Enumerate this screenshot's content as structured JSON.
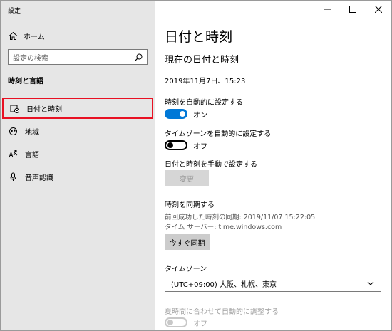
{
  "app": {
    "title": "設定"
  },
  "window_controls": {
    "minimize": "–",
    "maximize": "□",
    "close": "✕"
  },
  "sidebar": {
    "home_label": "ホーム",
    "search_placeholder": "設定の検索",
    "section_title": "時刻と言語",
    "items": [
      {
        "label": "日付と時刻",
        "icon": "calendar-clock-icon",
        "selected": true
      },
      {
        "label": "地域",
        "icon": "globe-region-icon",
        "selected": false
      },
      {
        "label": "言語",
        "icon": "language-icon",
        "selected": false
      },
      {
        "label": "音声認識",
        "icon": "microphone-icon",
        "selected": false
      }
    ]
  },
  "main": {
    "title": "日付と時刻",
    "subtitle": "現在の日付と時刻",
    "current_datetime": "2019年11月7日、15:23",
    "auto_time": {
      "label": "時刻を自動的に設定する",
      "state": "オン"
    },
    "auto_timezone": {
      "label": "タイムゾーンを自動的に設定する",
      "state": "オフ"
    },
    "manual": {
      "label": "日付と時刻を手動で設定する",
      "button": "変更"
    },
    "sync": {
      "title": "時刻を同期する",
      "last_sync": "前回成功した時刻の同期: 2019/11/07 15:22:05",
      "server": "タイム サーバー: time.windows.com",
      "button": "今すぐ同期"
    },
    "timezone": {
      "label": "タイムゾーン",
      "value": "(UTC+09:00) 大阪、札幌、東京"
    },
    "dst": {
      "label": "夏時間に合わせて自動的に調整する",
      "state": "オフ"
    }
  },
  "colors": {
    "accent": "#0078d7",
    "highlight_border": "#e81123",
    "sidebar_bg": "#e6e6e6"
  }
}
